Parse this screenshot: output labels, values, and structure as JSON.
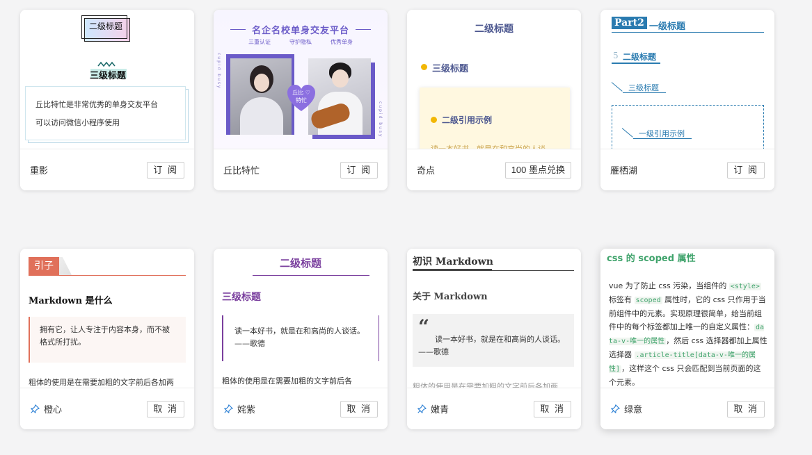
{
  "cards": [
    {
      "name": "重影",
      "button": "订 阅",
      "h2": "二级标题",
      "h3": "三级标题",
      "lines": [
        "丘比特忙是非常优秀的单身交友平台",
        "可以访问微信小程序使用"
      ]
    },
    {
      "name": "丘比特忙",
      "button": "订 阅",
      "title": "名企名校单身交友平台",
      "tags": [
        "三重认证",
        "守护隐私",
        "优秀单身"
      ],
      "heart": "丘比 ♡\n特忙",
      "side_text": "cupid busy"
    },
    {
      "name": "奇点",
      "button": "100 墨点兑换",
      "h2": "二级标题",
      "h3": "三级标题",
      "quote_title": "二级引用示例",
      "quote_text": "读一本好书，就是在和高尚的人谈"
    },
    {
      "name": "雁栖湖",
      "button": "订 阅",
      "part": "Part2",
      "h1": "一级标题",
      "num": "5",
      "h2": "二级标题",
      "h3": "三级标题",
      "quote": "一级引用示例"
    },
    {
      "name": "橙心",
      "button": "取 消",
      "tag": "引子",
      "h": "Markdown 是什么",
      "quote": "拥有它，让人专注于内容本身，而不被格式所打扰。",
      "para": "粗体的使用是在需要加粗的文字前后各加两"
    },
    {
      "name": "姹紫",
      "button": "取 消",
      "h2": "二级标题",
      "h3": "三级标题",
      "quote": "读一本好书，就是在和高尚的人谈话。 ——歌德",
      "para": "粗体的使用是在需要加粗的文字前后各"
    },
    {
      "name": "嫩青",
      "button": "取 消",
      "h1": "初识 Markdown",
      "h2": "关于 Markdown",
      "quote": "读一本好书，就是在和高尚的人谈话。——歌德",
      "para": "粗体的使用是在需要加粗的文字前后各加两"
    },
    {
      "name": "绿意",
      "button": "取 消",
      "h": "css 的 scoped 属性",
      "t1": "vue 为了防止 css 污染，当组件的 ",
      "c1": "<style>",
      "t2": " 标签有 ",
      "c2": "scoped",
      "t3": " 属性时，它的 css 只作用于当前组件中的元素。实现原理很简单，给当前组件中的每个标签都加上唯一的自定义属性：",
      "c3": "data-v-唯一的属性",
      "t4": "，然后 css 选择器都加上属性选择器 ",
      "c4": ".article-title[data-v-唯一的属性]",
      "t5": "，这样这个 css 只会匹配到当前页面的这个元素。"
    }
  ]
}
